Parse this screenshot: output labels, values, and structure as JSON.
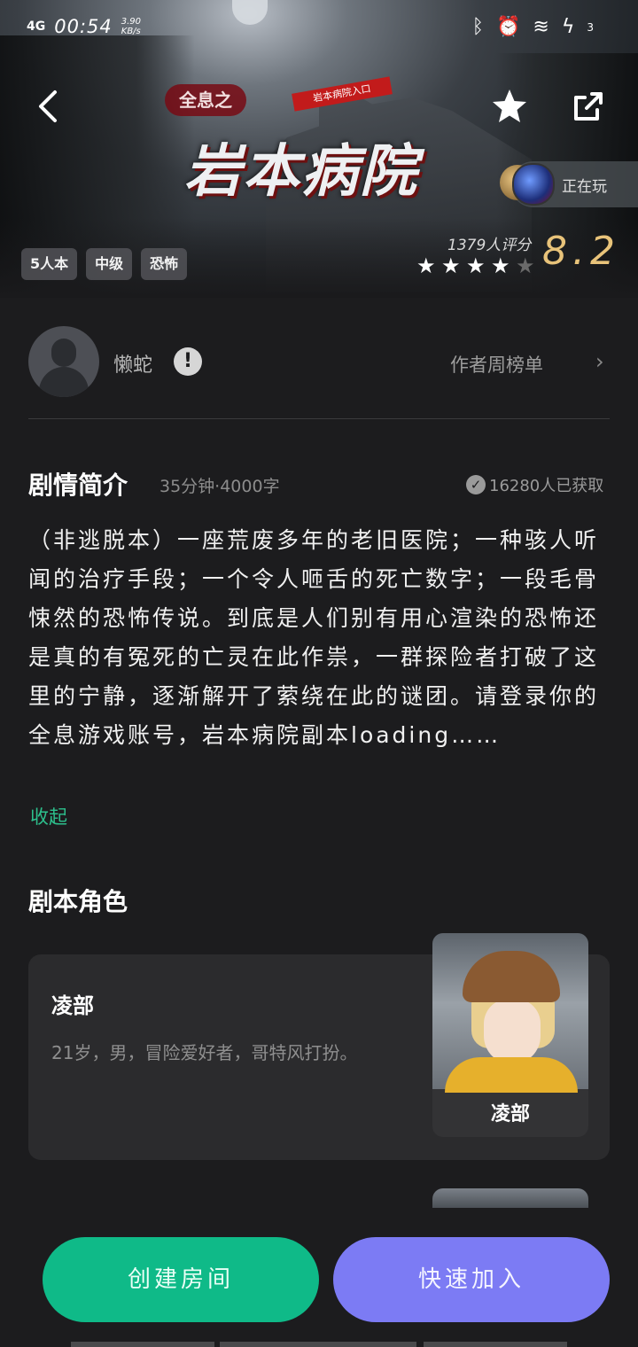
{
  "status_bar": {
    "network": "4G",
    "time": "00:54",
    "speed_value": "3.90",
    "speed_unit": "KB/s",
    "battery": "3",
    "icons": [
      "bluetooth-icon",
      "alarm-icon",
      "wifi-icon",
      "charging-icon"
    ]
  },
  "hero": {
    "logo_text": "全息之",
    "banner_text": "岩本病院入口",
    "title": "岩本病院",
    "playing_label": "正在玩",
    "tags": [
      "5人本",
      "中级",
      "恐怖"
    ],
    "rating_count": "1379人评分",
    "stars": 4,
    "stars_max": 5,
    "score": "8.2"
  },
  "author": {
    "name": "懒蛇",
    "rank_label": "作者周榜单"
  },
  "intro": {
    "title": "剧情简介",
    "meta": "35分钟·4000字",
    "acquired": "16280人已获取",
    "text": "（非逃脱本）一座荒废多年的老旧医院；一种骇人听闻的治疗手段；一个令人咂舌的死亡数字；一段毛骨悚然的恐怖传说。到底是人们别有用心渲染的恐怖还是真的有冤死的亡灵在此作祟，一群探险者打破了这里的宁静，逐渐解开了萦绕在此的谜团。请登录你的全息游戏账号，岩本病院副本loading……",
    "collapse_label": "收起"
  },
  "roles": {
    "title": "剧本角色",
    "items": [
      {
        "name": "凌部",
        "desc": "21岁，男，冒险爱好者，哥特风打扮。",
        "portrait_label": "凌部"
      }
    ]
  },
  "actions": {
    "create": "创建房间",
    "join": "快速加入"
  },
  "colors": {
    "accent_green": "#0fba88",
    "accent_purple": "#7c7bf4",
    "score_gold": "#e8c37a",
    "background": "#1c1c1e"
  }
}
